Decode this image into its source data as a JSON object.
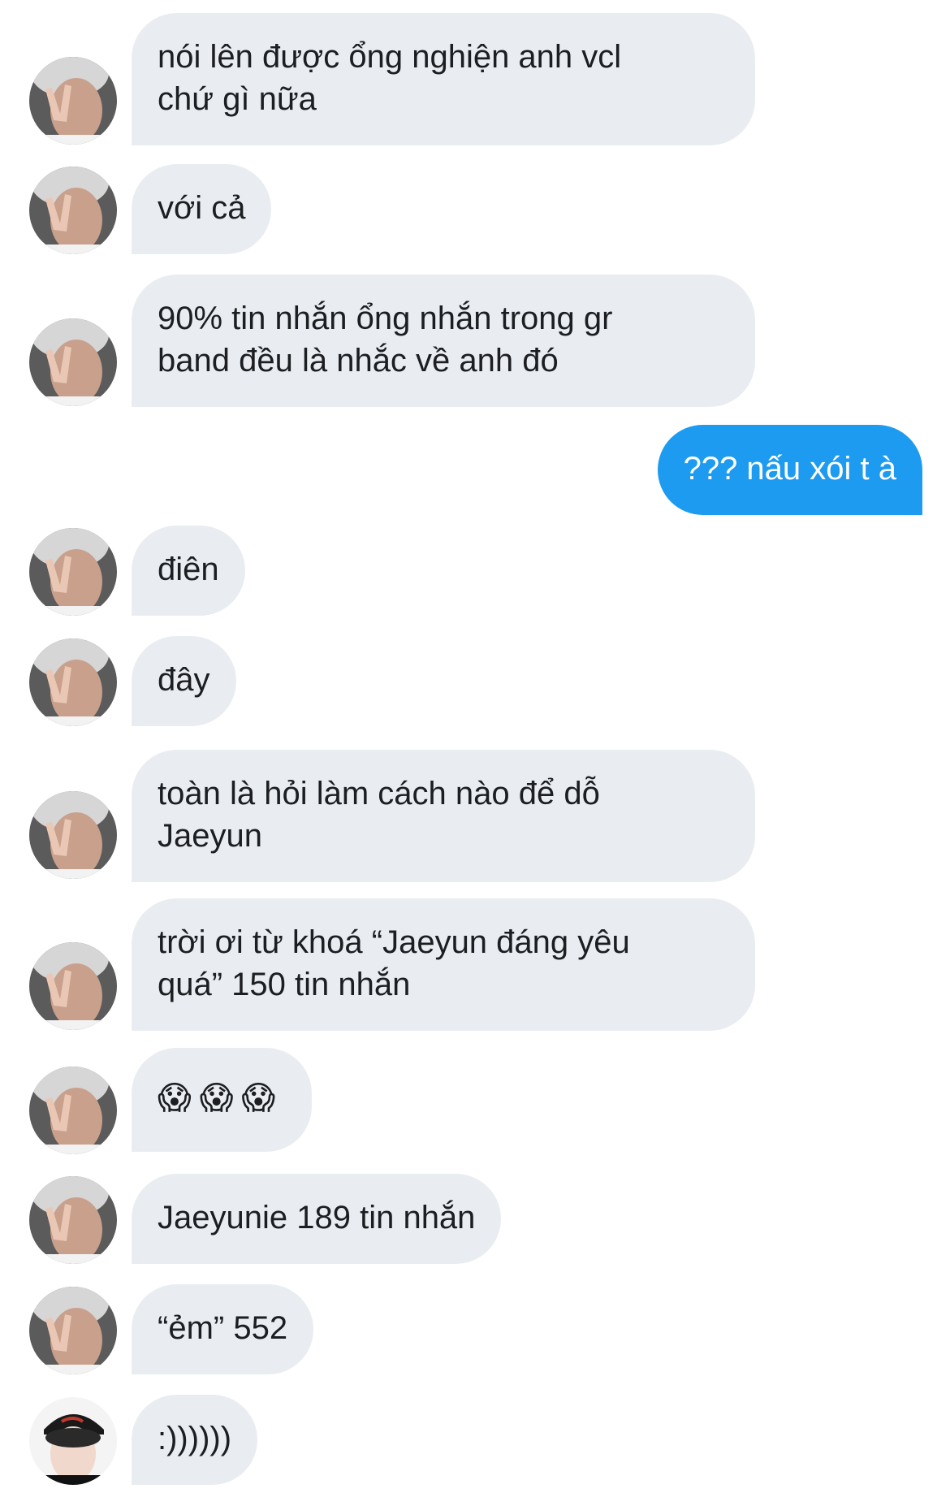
{
  "colors": {
    "incoming_bubble": "#e9edf2",
    "outgoing_bubble": "#1d9bf0",
    "incoming_text": "#1c1e21",
    "outgoing_text": "#ffffff"
  },
  "messages": [
    {
      "from": "them",
      "avatar": "avatar-peace-sign-icon",
      "lines": [
        "nói lên được ổng nghiện anh vcl",
        "chứ gì nữa"
      ]
    },
    {
      "from": "them",
      "avatar": "avatar-peace-sign-icon",
      "lines": [
        "với cả"
      ]
    },
    {
      "from": "them",
      "avatar": "avatar-peace-sign-icon",
      "lines": [
        "90% tin nhắn ổng nhắn trong gr",
        "band đều là nhắc về anh đó"
      ]
    },
    {
      "from": "me",
      "lines": [
        "??? nấu xói t à"
      ]
    },
    {
      "from": "them",
      "avatar": "avatar-peace-sign-icon",
      "lines": [
        "điên"
      ]
    },
    {
      "from": "them",
      "avatar": "avatar-peace-sign-icon",
      "lines": [
        "đây"
      ]
    },
    {
      "from": "them",
      "avatar": "avatar-peace-sign-icon",
      "lines": [
        "toàn là hỏi làm cách nào để  dỗ",
        "Jaeyun"
      ]
    },
    {
      "from": "them",
      "avatar": "avatar-peace-sign-icon",
      "lines": [
        "trời ơi từ khoá “Jaeyun đáng yêu",
        "quá” 150 tin nhắn"
      ]
    },
    {
      "from": "them",
      "avatar": "avatar-peace-sign-icon",
      "lines": [
        "😱😱😱"
      ]
    },
    {
      "from": "them",
      "avatar": "avatar-peace-sign-icon",
      "lines": [
        "Jaeyunie 189 tin nhắn"
      ]
    },
    {
      "from": "them",
      "avatar": "avatar-peace-sign-icon",
      "lines": [
        "“ẻm” 552"
      ]
    },
    {
      "from": "them",
      "avatar": "avatar-cap-icon",
      "lines": [
        ":))))))"
      ]
    }
  ]
}
